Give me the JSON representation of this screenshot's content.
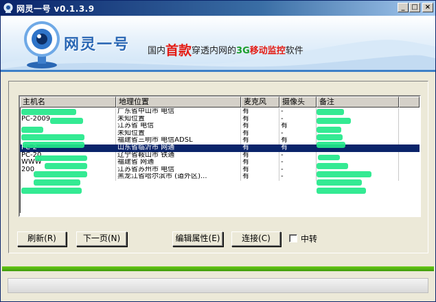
{
  "window": {
    "title": "网灵一号 v0.1.3.9",
    "buttons": {
      "minimize": "_",
      "maximize": "□",
      "close": "×"
    }
  },
  "banner": {
    "logo_text": "网灵一号",
    "slogan_parts": [
      "国内",
      "首款",
      "穿透内网的",
      "3G",
      "移动监控",
      "软件"
    ]
  },
  "table": {
    "columns": [
      "主机名",
      "地理位置",
      "麦克风",
      "摄像头",
      "备注"
    ],
    "rows": [
      {
        "host": "",
        "location": "广东省中山市 电信",
        "mic": "有",
        "cam": "-",
        "note": ""
      },
      {
        "host": "PC-2009",
        "location": "未知位置",
        "mic": "有",
        "cam": "-",
        "note": ""
      },
      {
        "host": "",
        "location": "江苏省 电信",
        "mic": "有",
        "cam": "有",
        "note": ""
      },
      {
        "host": "",
        "location": "未知位置",
        "mic": "有",
        "cam": "-",
        "note": ""
      },
      {
        "host": "",
        "location": "福建省三明市 电信ADSL",
        "mic": "有",
        "cam": "有",
        "note": ""
      },
      {
        "host": "PC-2",
        "location": "山东省临沂市 网通",
        "mic": "有",
        "cam": "有",
        "note": "",
        "selected": true
      },
      {
        "host": "PC-20",
        "location": "辽宁省鞍山市 铁通",
        "mic": "有",
        "cam": "-",
        "note": ""
      },
      {
        "host": "WWW",
        "location": "福建省 网通",
        "mic": "有",
        "cam": "-",
        "note": ""
      },
      {
        "host": "200",
        "location": "江苏省苏州市 电信",
        "mic": "有",
        "cam": "-",
        "note": ""
      },
      {
        "host": "",
        "location": "黑龙江省哈尔滨市 (道外区)...",
        "mic": "有",
        "cam": "-",
        "note": ""
      }
    ]
  },
  "actions": {
    "refresh": "刷新(R)",
    "next_page": "下一页(N)",
    "edit_props": "编辑属性(E)",
    "connect": "连接(C)",
    "relay_label": "中转"
  },
  "colors": {
    "title_bar": "#0a246a",
    "selection": "#0a246a",
    "banner_blue": "#3d7fc7",
    "footer_green": "#3e9b0b",
    "redaction": "#23e88a"
  }
}
